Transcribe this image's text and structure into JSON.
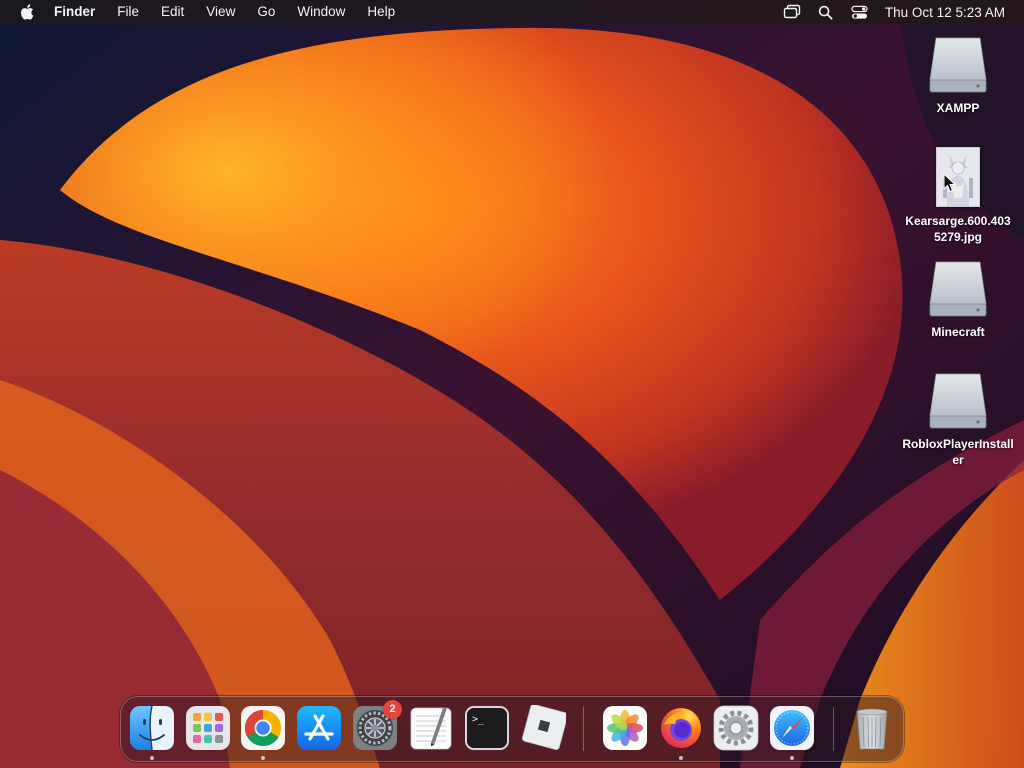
{
  "menubar": {
    "apple_icon": "apple-logo-icon",
    "app_name": "Finder",
    "menus": [
      "File",
      "Edit",
      "View",
      "Go",
      "Window",
      "Help"
    ],
    "status_icons": [
      "screen-mirroring-icon",
      "spotlight-search-icon",
      "control-center-icon"
    ],
    "clock": "Thu Oct 12  5:23 AM"
  },
  "desktop": {
    "icons": [
      {
        "label": "XAMPP",
        "kind": "disk-image"
      },
      {
        "label": "Kearsarge.600.4035279.jpg",
        "kind": "image-file"
      },
      {
        "label": "Minecraft",
        "kind": "disk-image"
      },
      {
        "label": "RobloxPlayerInstaller",
        "kind": "disk-image"
      }
    ]
  },
  "dock": {
    "apps": [
      {
        "name": "Finder",
        "icon": "finder-icon",
        "running": true
      },
      {
        "name": "Launchpad",
        "icon": "launchpad-icon",
        "running": false
      },
      {
        "name": "Google Chrome",
        "icon": "chrome-icon",
        "running": true
      },
      {
        "name": "App Store",
        "icon": "app-store-icon",
        "running": false
      },
      {
        "name": "System Preferences",
        "icon": "system-preferences-icon",
        "running": false,
        "badge": "2"
      },
      {
        "name": "TextEdit",
        "icon": "textedit-icon",
        "running": false
      },
      {
        "name": "Terminal",
        "icon": "terminal-icon",
        "running": false
      },
      {
        "name": "Roblox",
        "icon": "roblox-icon",
        "running": false
      },
      {
        "name": "Photos",
        "icon": "photos-icon",
        "running": false
      },
      {
        "name": "Firefox",
        "icon": "firefox-icon",
        "running": true
      },
      {
        "name": "System Settings",
        "icon": "settings-gear-icon",
        "running": false
      },
      {
        "name": "Safari",
        "icon": "safari-icon",
        "running": true
      },
      {
        "name": "Trash",
        "icon": "trash-icon",
        "running": false
      }
    ]
  },
  "colors": {
    "wallpaper_dark": "#101a36",
    "wallpaper_orange": "#f07a1c",
    "wallpaper_red": "#d8401e",
    "badge_red": "#e8423a"
  }
}
